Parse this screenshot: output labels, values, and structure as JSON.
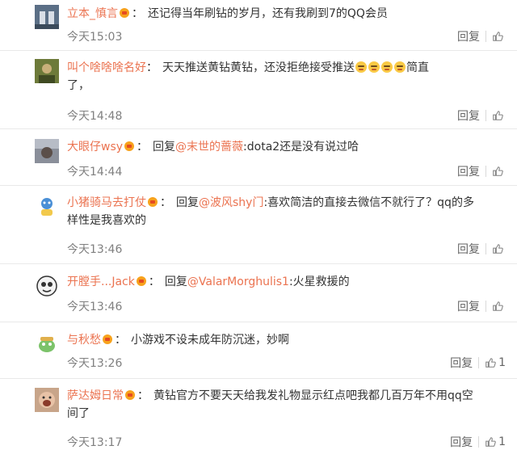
{
  "comments": [
    {
      "username": "立本_慎言",
      "text": "还记得当年刷钻的岁月，还有我刷到7的QQ会员",
      "time": "今天15:03",
      "reply_label": "回复",
      "likes": ""
    },
    {
      "username": "叫个啥啥啥名好",
      "text_before_emoji": "天天推送黄钻黄钻，还没拒绝接受推送",
      "emoji_count": 4,
      "text_after_emoji": "简直",
      "text_line2": "了，",
      "time": "今天14:48",
      "reply_label": "回复",
      "likes": ""
    },
    {
      "username": "大眼仔wsy",
      "reply_prefix": "回复",
      "mention": "@末世的蔷薇",
      "text": ":dota2还是没有说过哈",
      "time": "今天14:44",
      "reply_label": "回复",
      "likes": ""
    },
    {
      "username": "小猪骑马去打仗",
      "reply_prefix": "回复",
      "mention": "@波风shy门",
      "text": ":喜欢简洁的直接去微信不就行了？qq的多",
      "text_line2": "样性是我喜欢的",
      "time": "今天13:46",
      "reply_label": "回复",
      "likes": ""
    },
    {
      "username": "开膛手...Jack",
      "reply_prefix": "回复",
      "mention": "@ValarMorghulis1",
      "text": ":火星救援的",
      "time": "今天13:46",
      "reply_label": "回复",
      "likes": ""
    },
    {
      "username": "与秋愁",
      "text": "小游戏不设未成年防沉迷，妙啊",
      "time": "今天13:26",
      "reply_label": "回复",
      "likes": "1"
    },
    {
      "username": "萨达姆日常",
      "text": "黄钻官方不要天天给我发礼物显示红点吧我都几百万年不用qq空",
      "text_line2": "间了",
      "time": "今天13:17",
      "reply_label": "回复",
      "likes": "1"
    }
  ],
  "colors": {
    "username": "#eb7350",
    "text": "#333333",
    "meta": "#808080",
    "divider": "#e9e9e9",
    "vip_badge": "#f7a21c"
  },
  "icons": {
    "vip_badge": "vip-crown-icon",
    "like": "thumbs-up-icon",
    "emoji": "sweat-smile-emoji-icon"
  }
}
